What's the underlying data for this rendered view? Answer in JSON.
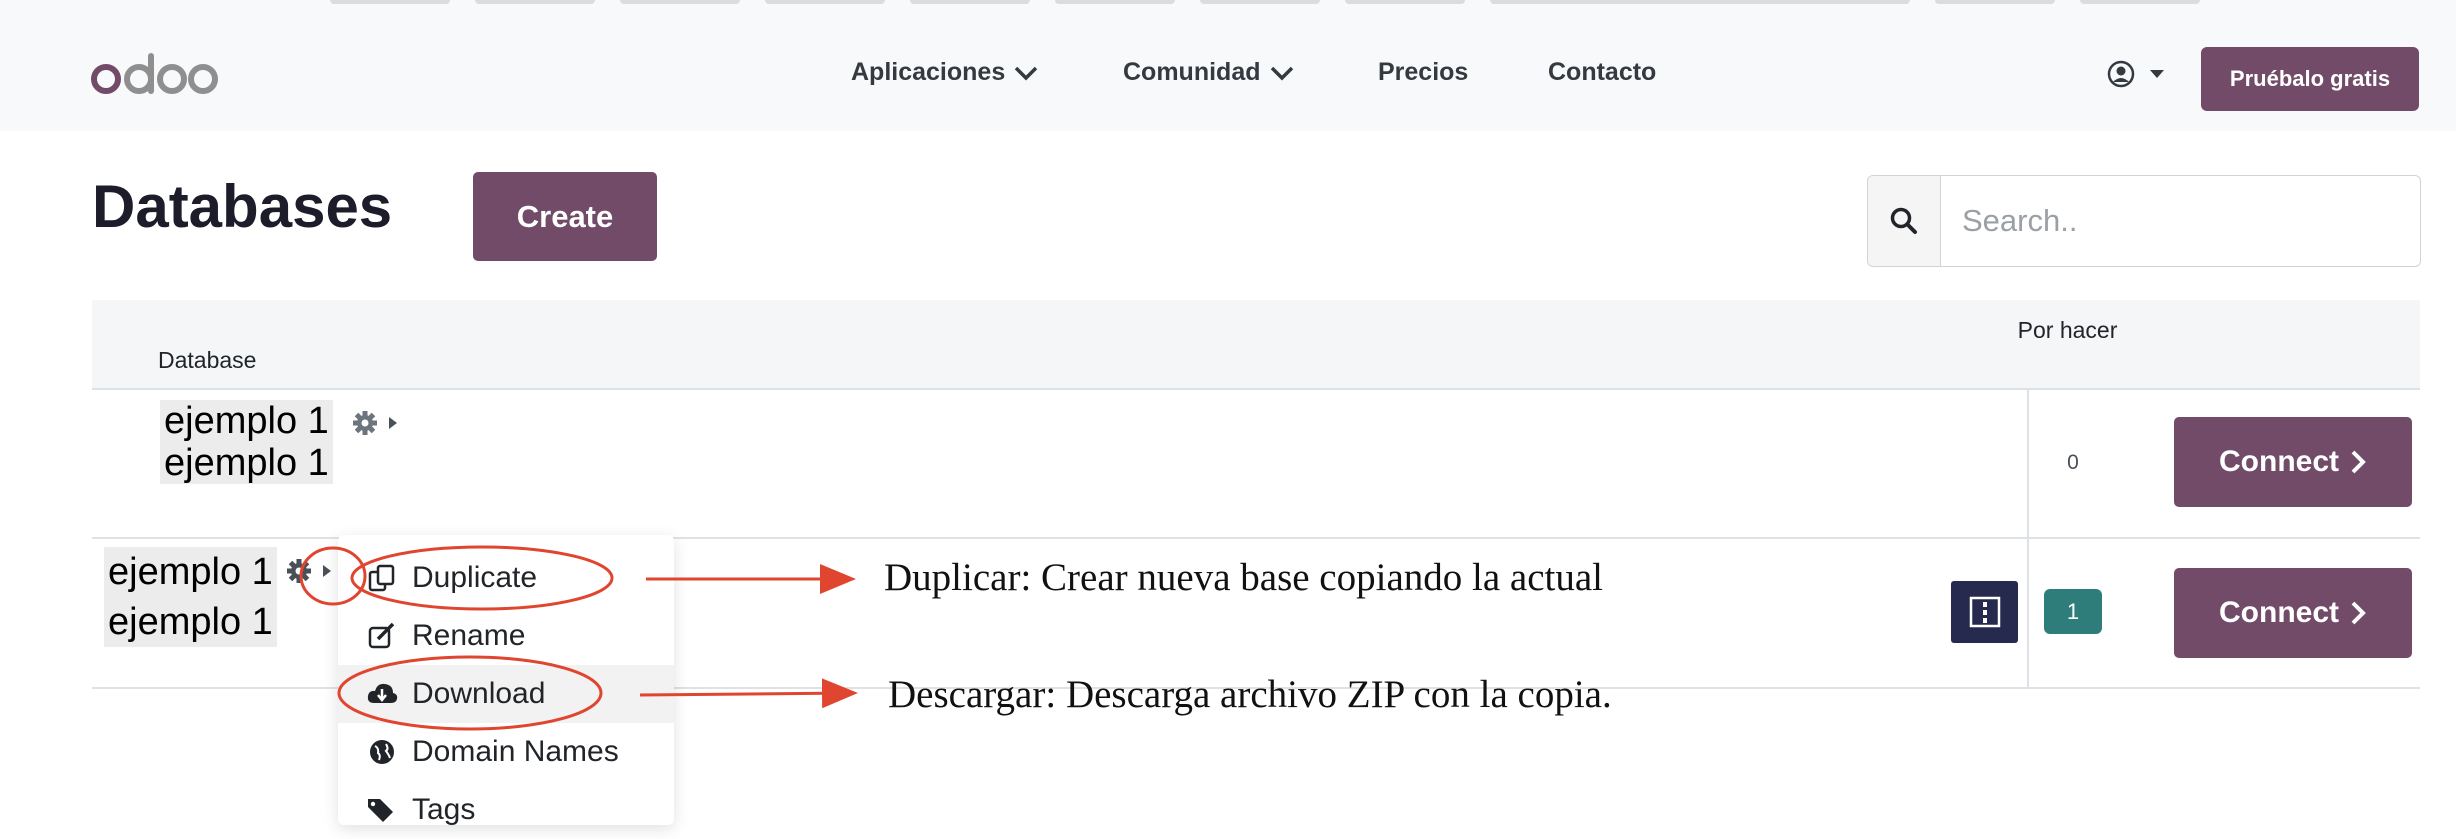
{
  "nav": {
    "brand": "odoo",
    "menu": [
      {
        "label": "Aplicaciones",
        "has_dropdown": true
      },
      {
        "label": "Comunidad",
        "has_dropdown": true
      },
      {
        "label": "Precios",
        "has_dropdown": false
      },
      {
        "label": "Contacto",
        "has_dropdown": false
      }
    ],
    "user_icon": "user-circle-icon",
    "cta_label": "Pruébalo gratis"
  },
  "page": {
    "title": "Databases",
    "create_label": "Create",
    "search_placeholder": "Search.."
  },
  "table": {
    "headers": {
      "database": "Database",
      "todo": "Por hacer"
    },
    "rows": [
      {
        "name_line1": "ejemplo 1",
        "name_line2": "ejemplo 1",
        "todo_count": "0",
        "connect_label": "Connect"
      },
      {
        "name_line1": "ejemplo 1",
        "name_line2": "ejemplo 1",
        "todo_count": "1",
        "connect_label": "Connect"
      }
    ]
  },
  "dropdown": {
    "items": [
      {
        "label": "Duplicate",
        "icon": "copy-icon"
      },
      {
        "label": "Rename",
        "icon": "edit-icon"
      },
      {
        "label": "Download",
        "icon": "cloud-download-icon"
      },
      {
        "label": "Domain Names",
        "icon": "globe-icon"
      },
      {
        "label": "Tags",
        "icon": "tags-icon"
      }
    ]
  },
  "annotations": {
    "duplicate_note": "Duplicar: Crear nueva base copiando la actual",
    "download_note": "Descargar: Descarga archivo ZIP con la copia."
  },
  "colors": {
    "brand_primary": "#714b67",
    "badge_teal": "#2e7d7b",
    "annotation_red": "#e0452f",
    "qr_button": "#262a4f"
  }
}
